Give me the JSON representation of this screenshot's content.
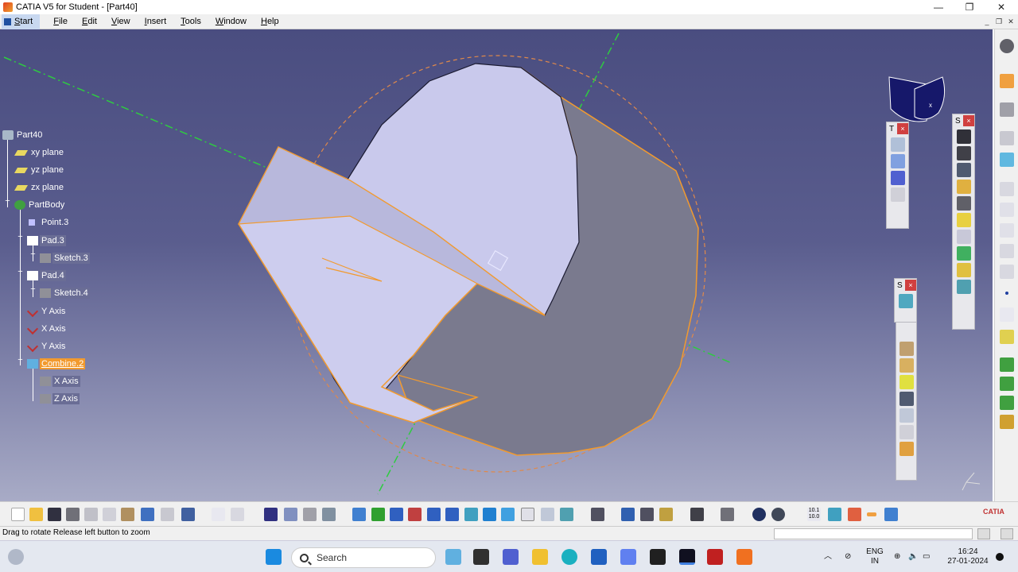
{
  "window": {
    "title": "CATIA V5 for Student - [Part40]",
    "minimize": "—",
    "restore": "❐",
    "close": "✕"
  },
  "menu": {
    "items": [
      "Start",
      "File",
      "Edit",
      "View",
      "Insert",
      "Tools",
      "Window",
      "Help"
    ]
  },
  "tree": {
    "root": "Part40",
    "xy": "xy plane",
    "yz": "yz plane",
    "zx": "zx plane",
    "body": "PartBody",
    "point": "Point.3",
    "pad3": "Pad.3",
    "sketch3": "Sketch.3",
    "pad4": "Pad.4",
    "sketch4": "Sketch.4",
    "yaxis1": "Y Axis",
    "xaxis1": "X Axis",
    "yaxis2": "Y Axis",
    "combine": "Combine.2",
    "xaxis2": "X Axis",
    "zaxis": "Z Axis"
  },
  "floating_toolbars": {
    "t_title": "T",
    "s1_title": "S",
    "s2_title": "S",
    "close": "×"
  },
  "status": {
    "text": "Drag to rotate  Release left button to zoom"
  },
  "taskbar": {
    "search_placeholder": "Search",
    "lang_top": "ENG",
    "lang_bottom": "IN",
    "time": "16:24",
    "date": "27-01-2024"
  },
  "colors": {
    "viewport_top": "#4a4d80",
    "viewport_bottom": "#a8abc6",
    "highlight_edge": "#f29a2e",
    "axis_green": "#2ecc40",
    "selected_node": "#f29a2e"
  }
}
